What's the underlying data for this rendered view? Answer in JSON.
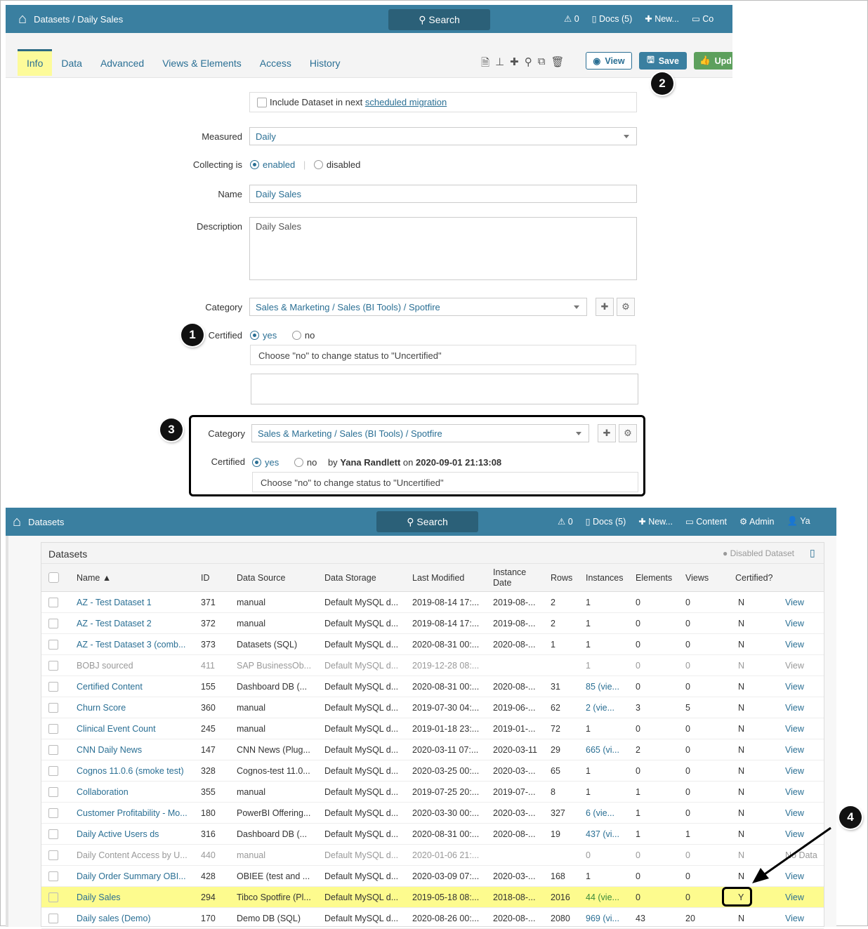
{
  "top": {
    "breadcrumb": "Datasets / Daily Sales",
    "search": "Search",
    "alerts": "0",
    "docs": "Docs (5)",
    "new": "New...",
    "content_trunc": "Co",
    "tabs": [
      "Info",
      "Data",
      "Advanced",
      "Views & Elements",
      "Access",
      "History"
    ],
    "view_btn": "View",
    "save_btn": "Save",
    "update_btn": "Upd",
    "migration_text": "Include Dataset in next ",
    "migration_link": "scheduled migration",
    "measured_label": "Measured",
    "measured_value": "Daily",
    "collecting_label": "Collecting is",
    "enabled": "enabled",
    "disabled": "disabled",
    "name_label": "Name",
    "name_value": "Daily Sales",
    "description_label": "Description",
    "description_value": "Daily Sales",
    "category_label": "Category",
    "category_value": "Sales & Marketing / Sales (BI Tools) / Spotfire",
    "certified_label": "Certified",
    "yes": "yes",
    "no": "no",
    "certified_hint": "Choose \"no\" to change status to \"Uncertified\""
  },
  "callout": {
    "category_label": "Category",
    "category_value": "Sales & Marketing / Sales (BI Tools) / Spotfire",
    "certified_label": "Certified",
    "yes": "yes",
    "no": "no",
    "by": "by",
    "user": "Yana Randlett",
    "on": "on",
    "datetime": "2020-09-01 21:13:08",
    "hint": "Choose \"no\" to change status to \"Uncertified\""
  },
  "badges": [
    "1",
    "2",
    "3",
    "4"
  ],
  "bottom": {
    "breadcrumb": "Datasets",
    "search": "Search",
    "alerts": "0",
    "docs": "Docs (5)",
    "new": "New...",
    "content": "Content",
    "admin": "Admin",
    "user_trunc": "Ya",
    "panel_title": "Datasets",
    "disabled_legend": "Disabled Dataset",
    "columns": [
      "Name ▲",
      "ID",
      "Data Source",
      "Data Storage",
      "Last Modified",
      "Instance Date",
      "Rows",
      "Instances",
      "Elements",
      "Views",
      "Certified?"
    ],
    "rows": [
      [
        "AZ - Test Dataset 1",
        "371",
        "manual",
        "Default MySQL d...",
        "2019-08-14 17:...",
        "2019-08-...",
        "2",
        "1",
        "0",
        "0",
        "N",
        "View"
      ],
      [
        "AZ - Test Dataset 2",
        "372",
        "manual",
        "Default MySQL d...",
        "2019-08-14 17:...",
        "2019-08-...",
        "2",
        "1",
        "0",
        "0",
        "N",
        "View"
      ],
      [
        "AZ - Test Dataset 3 (comb...",
        "373",
        "Datasets (SQL)",
        "Default MySQL d...",
        "2020-08-31 00:...",
        "2020-08-...",
        "1",
        "1",
        "0",
        "0",
        "N",
        "View"
      ],
      [
        "BOBJ sourced",
        "411",
        "SAP BusinessOb...",
        "Default MySQL d...",
        "2019-12-28 08:...",
        "",
        "",
        "1",
        "0",
        "0",
        "N",
        "View"
      ],
      [
        "Certified Content",
        "155",
        "Dashboard DB (...",
        "Default MySQL d...",
        "2020-08-31 00:...",
        "2020-08-...",
        "31",
        "85 (vie...",
        "0",
        "0",
        "N",
        "View"
      ],
      [
        "Churn Score",
        "360",
        "manual",
        "Default MySQL d...",
        "2019-07-30 04:...",
        "2019-06-...",
        "62",
        "2 (vie...",
        "3",
        "5",
        "N",
        "View"
      ],
      [
        "Clinical Event Count",
        "245",
        "manual",
        "Default MySQL d...",
        "2019-01-18 23:...",
        "2019-01-...",
        "72",
        "1",
        "0",
        "0",
        "N",
        "View"
      ],
      [
        "CNN Daily News",
        "147",
        "CNN News (Plug...",
        "Default MySQL d...",
        "2020-03-11 07:...",
        "2020-03-11",
        "29",
        "665 (vi...",
        "2",
        "0",
        "N",
        "View"
      ],
      [
        "Cognos 11.0.6 (smoke test)",
        "328",
        "Cognos-test 11.0...",
        "Default MySQL d...",
        "2020-03-25 00:...",
        "2020-03-...",
        "65",
        "1",
        "0",
        "0",
        "N",
        "View"
      ],
      [
        "Collaboration",
        "355",
        "manual",
        "Default MySQL d...",
        "2019-07-25 20:...",
        "2019-07-...",
        "8",
        "1",
        "1",
        "0",
        "N",
        "View"
      ],
      [
        "Customer Profitability - Mo...",
        "180",
        "PowerBI Offering...",
        "Default MySQL d...",
        "2020-03-30 00:...",
        "2020-03-...",
        "327",
        "6 (vie...",
        "1",
        "0",
        "N",
        "View"
      ],
      [
        "Daily Active Users ds",
        "316",
        "Dashboard DB (...",
        "Default MySQL d...",
        "2020-08-31 00:...",
        "2020-08-...",
        "19",
        "437 (vi...",
        "1",
        "1",
        "N",
        "View"
      ],
      [
        "Daily Content Access by U...",
        "440",
        "manual",
        "Default MySQL d...",
        "2020-01-06 21:...",
        "",
        "",
        "0",
        "0",
        "0",
        "N",
        "No Data"
      ],
      [
        "Daily Order Summary OBI...",
        "428",
        "OBIEE (test and ...",
        "Default MySQL d...",
        "2020-03-09 07:...",
        "2020-03-...",
        "168",
        "1",
        "0",
        "0",
        "N",
        "View"
      ],
      [
        "Daily Sales",
        "294",
        "Tibco Spotfire (Pl...",
        "Default MySQL d...",
        "2019-05-18 08:...",
        "2018-08-...",
        "2016",
        "44 (vie...",
        "0",
        "0",
        "Y",
        "View"
      ],
      [
        "Daily sales (Demo)",
        "170",
        "Demo DB (SQL)",
        "Default MySQL d...",
        "2020-08-26 00:...",
        "2020-08-...",
        "2080",
        "969 (vi...",
        "43",
        "20",
        "N",
        "View"
      ]
    ],
    "disabled_rows": [
      3,
      12
    ],
    "highlight_row": 14
  }
}
